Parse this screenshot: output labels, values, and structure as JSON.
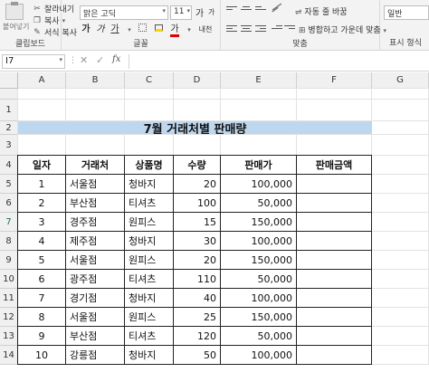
{
  "ribbon": {
    "clipboard": {
      "paste_label": "붙여넣기",
      "cut_label": "잘라내기",
      "copy_label": "복사",
      "format_painter_label": "서식 복사",
      "group_label": "클립보드"
    },
    "font": {
      "font_name": "맑은 고딕",
      "font_size": "11",
      "grow_label": "가",
      "shrink_label": "가",
      "bold": "가",
      "italic": "가",
      "underline": "가",
      "font_color_glyph": "가",
      "phonetic_label": "내천",
      "group_label": "글꼴"
    },
    "alignment": {
      "wrap_text_label": "자동 줄 바꿈",
      "merge_center_label": "병합하고 가운데 맞춤",
      "group_label": "맞춤"
    },
    "number": {
      "format_value": "일반",
      "group_label": "표시 형식"
    }
  },
  "formula_bar": {
    "name_box": "I7",
    "fx_label": "fx",
    "content": ""
  },
  "columns": [
    "A",
    "B",
    "C",
    "D",
    "E",
    "F",
    "G"
  ],
  "rows": [
    "1",
    "2",
    "3",
    "4",
    "5",
    "6",
    "7",
    "8",
    "9",
    "10",
    "11",
    "12",
    "13",
    "14"
  ],
  "sheet": {
    "title": "7월 거래처별 판매량",
    "headers": [
      "일자",
      "거래처",
      "상품명",
      "수량",
      "판매가",
      "판매금액"
    ],
    "data": [
      [
        "1",
        "서울점",
        "청바지",
        "20",
        "100,000",
        ""
      ],
      [
        "2",
        "부산점",
        "티셔츠",
        "100",
        "50,000",
        ""
      ],
      [
        "3",
        "경주점",
        "원피스",
        "15",
        "150,000",
        ""
      ],
      [
        "4",
        "제주점",
        "청바지",
        "30",
        "100,000",
        ""
      ],
      [
        "5",
        "서울점",
        "원피스",
        "20",
        "150,000",
        ""
      ],
      [
        "6",
        "광주점",
        "티셔츠",
        "110",
        "50,000",
        ""
      ],
      [
        "7",
        "경기점",
        "청바지",
        "40",
        "100,000",
        ""
      ],
      [
        "8",
        "서울점",
        "원피스",
        "25",
        "150,000",
        ""
      ],
      [
        "9",
        "부산점",
        "티셔츠",
        "120",
        "50,000",
        ""
      ],
      [
        "10",
        "강릉점",
        "청바지",
        "50",
        "100,000",
        ""
      ]
    ]
  }
}
